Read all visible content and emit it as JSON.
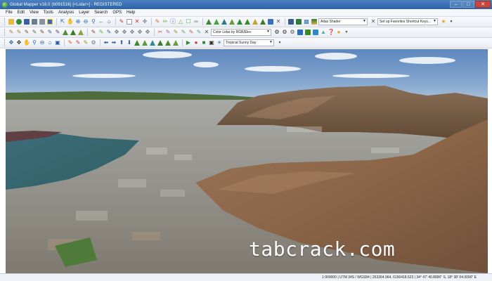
{
  "window": {
    "title": "Global Mapper v18.0 (b091516) [<Lidar>] - REGISTERED",
    "minimize": "–",
    "maximize": "□",
    "close": "✕"
  },
  "menu": [
    "File",
    "Edit",
    "View",
    "Tools",
    "Analysis",
    "Layer",
    "Search",
    "GPS",
    "Help"
  ],
  "toolbar": {
    "shader_select": "Atlas Shader",
    "favorites_select": "Set up Favorites Shortcut Keys...",
    "lidar_color_select": "Color Lidar by RGB/Elev",
    "sky_select": "Tropical Sunny Day"
  },
  "status": {
    "text": "1:909000 | UTM 34S / WGS84 | 263364.964, 6156418.523 | 34° 47' 40.8890\" S, 18° 38' 04.0090\" E"
  },
  "watermark": "tabcrack.com",
  "colors": {
    "title_bar": "#3b6fb3",
    "sky": "#6b92c4",
    "water": "#3c6e74",
    "terrain": "#8a6b4f"
  }
}
